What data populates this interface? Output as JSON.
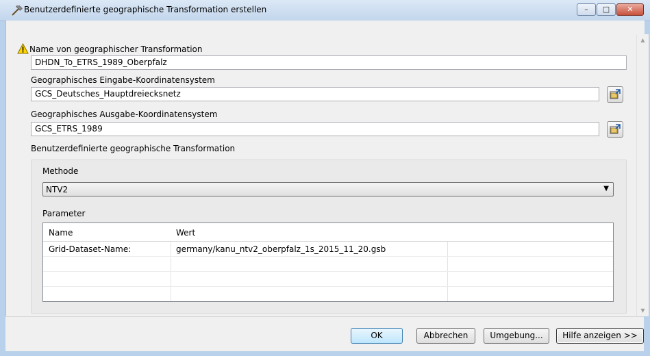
{
  "window": {
    "title": "Benutzerdefinierte geographische Transformation erstellen",
    "controls": {
      "minimize": "–",
      "maximize": "□",
      "close": "✕"
    }
  },
  "form": {
    "name_label": "Name von geographischer Transformation",
    "name_value": "DHDN_To_ETRS_1989_Oberpfalz",
    "input_cs_label": "Geographisches Eingabe-Koordinatensystem",
    "input_cs_value": "GCS_Deutsches_Hauptdreiecksnetz",
    "output_cs_label": "Geographisches Ausgabe-Koordinatensystem",
    "output_cs_value": "GCS_ETRS_1989",
    "custom_section_label": "Benutzerdefinierte geographische Transformation",
    "method_label": "Methode",
    "method_value": "NTV2",
    "parameter_label": "Parameter"
  },
  "table": {
    "headers": [
      "Name",
      "Wert",
      ""
    ],
    "rows": [
      [
        "Grid-Dataset-Name:",
        "germany/kanu_ntv2_oberpfalz_1s_2015_11_20.gsb",
        ""
      ],
      [
        "",
        "",
        ""
      ],
      [
        "",
        "",
        ""
      ],
      [
        "",
        "",
        ""
      ]
    ]
  },
  "buttons": {
    "ok": "OK",
    "cancel": "Abbrechen",
    "environment": "Umgebung...",
    "help": "Hilfe anzeigen >>"
  },
  "icons": {
    "title": "hammer-icon",
    "warning": "warning-icon",
    "browse": "browse-folder-icon"
  },
  "colors": {
    "titlebar": "#c3d6ec",
    "close_button": "#c8513d",
    "ok_button": "#bee6fd",
    "warning": "#ffd800"
  }
}
